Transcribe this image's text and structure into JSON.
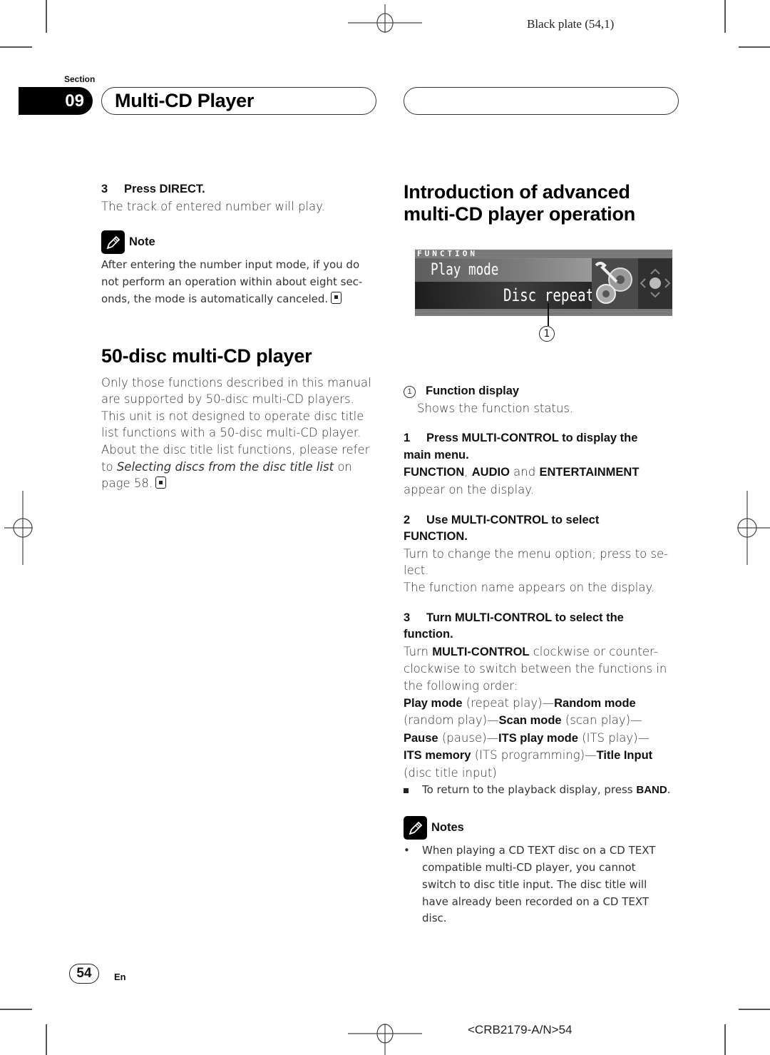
{
  "header": {
    "plate": "Black plate (54,1)",
    "section_label": "Section",
    "section_number": "09",
    "section_title": "Multi-CD Player"
  },
  "left": {
    "step3": {
      "num": "3",
      "title": "Press DIRECT.",
      "text": "The track of entered number will play."
    },
    "note": {
      "label": "Note",
      "lines": [
        "After entering the number input mode, if you do",
        "not perform an operation within about eight sec-",
        "onds, the mode is automatically canceled."
      ]
    },
    "disc50": {
      "heading": "50-disc multi-CD player",
      "lines": [
        "Only those functions described in this manual",
        "are supported by 50-disc multi-CD players.",
        "This unit is not designed to operate disc title",
        "list functions with a 50-disc multi-CD player.",
        "About the disc title list functions, please refer"
      ],
      "ref_prefix": "to ",
      "ref_italic": "Selecting discs from the disc title list",
      "ref_suffix": " on",
      "last_line": "page 58."
    }
  },
  "right": {
    "heading_line1": "Introduction of advanced",
    "heading_line2": "multi-CD player operation",
    "display": {
      "header": "FUNCTION",
      "row1": "Play mode",
      "row2": "Disc repeat",
      "callout": "1"
    },
    "legend": {
      "num": "1",
      "title": "Function display",
      "text": "Shows the function status."
    },
    "step1": {
      "num": "1",
      "title_a": "Press MULTI-CONTROL to display the",
      "title_b": "main menu.",
      "kw1": "FUNCTION",
      "sep1": ", ",
      "kw2": "AUDIO",
      "sep2": " and ",
      "kw3": "ENTERTAINMENT",
      "text2": "appear on the display."
    },
    "step2": {
      "num": "2",
      "title_a": "Use MULTI-CONTROL to select",
      "title_b": "FUNCTION.",
      "line1": "Turn to change the menu option; press to se-",
      "line2": "lect.",
      "line3": "The function name appears on the display."
    },
    "step3": {
      "num": "3",
      "title_a": "Turn MULTI-CONTROL to select the",
      "title_b": "function.",
      "turn": "Turn ",
      "kw": "MULTI-CONTROL",
      "rest1": " clockwise or counter-",
      "line2": "clockwise to switch between the functions in",
      "line3": "the following order:",
      "order": {
        "f1": "Play mode",
        "d1": " (repeat play)—",
        "f2": "Random mode",
        "d2": "(random play)—",
        "f3": "Scan mode",
        "d3": " (scan play)—",
        "f4": "Pause",
        "d4": " (pause)—",
        "f5": "ITS play mode",
        "d5": " (ITS play)—",
        "f6": "ITS memory",
        "d6": " (ITS programming)—",
        "f7": "Title Input",
        "d7": "(disc title input)"
      },
      "bullet_text": "To return to the playback display, press ",
      "bullet_kw": "BAND",
      "bullet_end": "."
    },
    "notes": {
      "label": "Notes",
      "items": [
        {
          "lines": [
            "When playing a CD TEXT disc on a CD TEXT",
            "compatible multi-CD player, you cannot",
            "switch to disc title input. The disc title will",
            "have already been recorded on a CD TEXT",
            "disc."
          ]
        }
      ]
    }
  },
  "footer": {
    "page_number": "54",
    "language": "En",
    "code": "<CRB2179-A/N>54"
  }
}
